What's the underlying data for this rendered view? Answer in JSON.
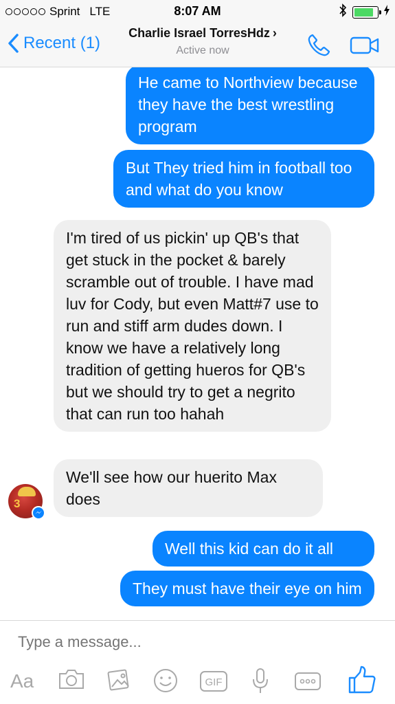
{
  "status_bar": {
    "carrier": "Sprint",
    "network": "LTE",
    "time": "8:07 AM",
    "battery_level": 0.85,
    "battery_color": "#4cd964"
  },
  "nav": {
    "back_label": "Recent (1)",
    "contact_name": "Charlie Israel TorresHdz",
    "chevron": "›",
    "status": "Active now",
    "accent": "#1a8cff"
  },
  "messages": [
    {
      "side": "out",
      "text": "He came to Northview because they have the best wrestling program"
    },
    {
      "side": "out",
      "text": "But They tried him in football too and  what do you know"
    },
    {
      "side": "in",
      "text": "I'm tired of us pickin' up QB's that get stuck in the pocket & barely scramble out of trouble. I have mad luv for Cody, but even Matt#7 use to run and stiff arm dudes down. I know we have a relatively long tradition of getting hueros for QB's but we should try to get a negrito that can run too hahah"
    },
    {
      "side": "in",
      "text": "We'll see how our huerito Max does"
    },
    {
      "side": "out",
      "text": "Well this kid can do it all"
    },
    {
      "side": "out",
      "text": "They must have their eye on him"
    }
  ],
  "avatar_number": "3",
  "composer": {
    "placeholder": "Type a message...",
    "aa_label": "Aa",
    "gif_label": "GIF"
  },
  "colors": {
    "outgoing_bubble": "#0a84ff",
    "incoming_bubble": "#efefef"
  }
}
